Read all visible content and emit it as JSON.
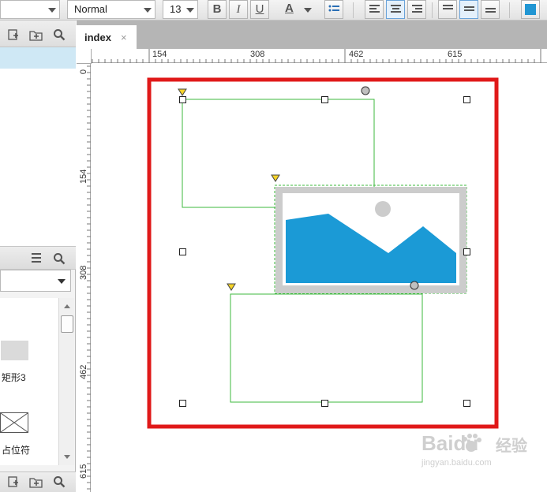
{
  "toolbar": {
    "style_value": "Normal",
    "font_size_value": "13",
    "bold_label": "B",
    "italic_label": "I",
    "underline_label": "U",
    "font_color_label": "A",
    "fill_color": "#2196d3"
  },
  "pages_panel": {
    "icons": [
      "add-page-icon",
      "add-folder-icon",
      "search-icon"
    ],
    "selected_page": ""
  },
  "canvas_tab": {
    "label": "index",
    "close_label": "×"
  },
  "rulers": {
    "horizontal": [
      "154",
      "308",
      "462",
      "615"
    ],
    "vertical": [
      "0",
      "154",
      "308",
      "462",
      "615"
    ]
  },
  "library": {
    "widgets": [
      {
        "label": "矩形3",
        "icon": "rectangle-widget-icon"
      },
      {
        "label": "占位符",
        "icon": "placeholder-widget-icon"
      }
    ]
  },
  "watermark": {
    "brand": "Baidu",
    "brand_cn": "经验",
    "url": "jingyan.baidu.com"
  },
  "colors": {
    "highlight_border": "#e01919",
    "guide_green": "#3cb83c",
    "image_blue": "#1b9ad6",
    "image_frame": "#cccccc"
  }
}
